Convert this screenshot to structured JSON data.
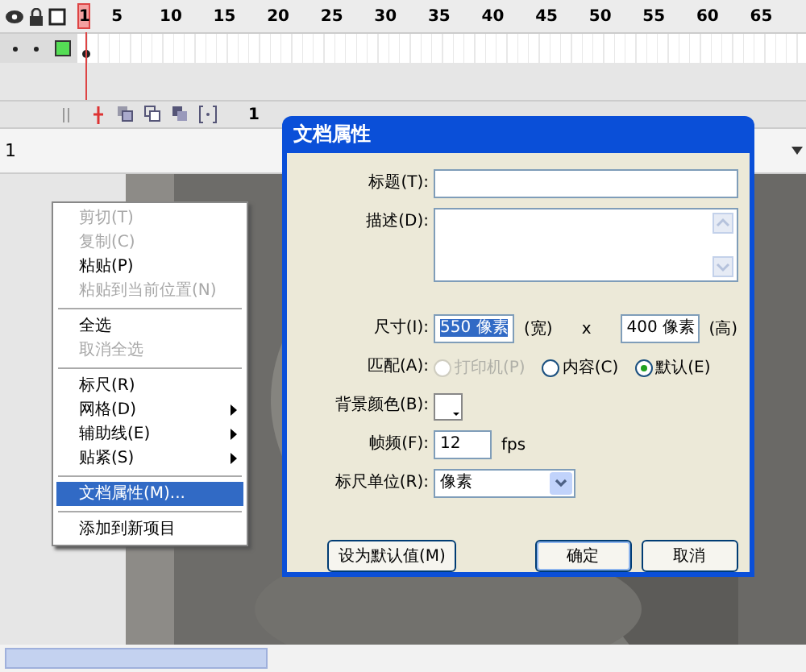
{
  "timeline": {
    "frame_numbers": [
      "1",
      "5",
      "10",
      "15",
      "20",
      "25",
      "30",
      "35",
      "40",
      "45",
      "50",
      "55",
      "60",
      "65"
    ]
  },
  "timeline_toolbar": {
    "current_frame": "1"
  },
  "edit_bar": {
    "scene": "1"
  },
  "context_menu": [
    {
      "kind": "item",
      "label": "剪切(T)",
      "disabled": true,
      "selected": false,
      "submenu": false
    },
    {
      "kind": "item",
      "label": "复制(C)",
      "disabled": true,
      "selected": false,
      "submenu": false
    },
    {
      "kind": "item",
      "label": "粘贴(P)",
      "disabled": false,
      "selected": false,
      "submenu": false
    },
    {
      "kind": "item",
      "label": "粘贴到当前位置(N)",
      "disabled": true,
      "selected": false,
      "submenu": false
    },
    {
      "kind": "separator"
    },
    {
      "kind": "item",
      "label": "全选",
      "disabled": false,
      "selected": false,
      "submenu": false
    },
    {
      "kind": "item",
      "label": "取消全选",
      "disabled": true,
      "selected": false,
      "submenu": false
    },
    {
      "kind": "separator"
    },
    {
      "kind": "item",
      "label": "标尺(R)",
      "disabled": false,
      "selected": false,
      "submenu": false
    },
    {
      "kind": "item",
      "label": "网格(D)",
      "disabled": false,
      "selected": false,
      "submenu": true
    },
    {
      "kind": "item",
      "label": "辅助线(E)",
      "disabled": false,
      "selected": false,
      "submenu": true
    },
    {
      "kind": "item",
      "label": "贴紧(S)",
      "disabled": false,
      "selected": false,
      "submenu": true
    },
    {
      "kind": "separator"
    },
    {
      "kind": "item",
      "label": "文档属性(M)...",
      "disabled": false,
      "selected": true,
      "submenu": false
    },
    {
      "kind": "separator"
    },
    {
      "kind": "item",
      "label": "添加到新项目",
      "disabled": false,
      "selected": false,
      "submenu": false
    }
  ],
  "dialog": {
    "title": "文档属性",
    "title_label": "标题(T):",
    "description_label": "描述(D):",
    "size_label": "尺寸(I):",
    "width_value": "550 像素",
    "width_unit": "(宽)",
    "times": "x",
    "height_value": "400 像素",
    "height_unit": "(高)",
    "match_label": "匹配(A):",
    "match_options": [
      {
        "label": "打印机(P)",
        "selected": false,
        "disabled": true
      },
      {
        "label": "内容(C)",
        "selected": false,
        "disabled": false
      },
      {
        "label": "默认(E)",
        "selected": true,
        "disabled": false
      }
    ],
    "background_label": "背景颜色(B):",
    "frame_rate_label": "帧频(F):",
    "frame_rate_value": "12",
    "frame_rate_unit": "fps",
    "ruler_units_label": "标尺单位(R):",
    "ruler_units_value": "像素",
    "buttons": [
      {
        "kind": "secondary",
        "label": "设为默认值(M)"
      },
      {
        "kind": "default",
        "label": "确定"
      },
      {
        "kind": "secondary",
        "label": "取消"
      }
    ]
  }
}
